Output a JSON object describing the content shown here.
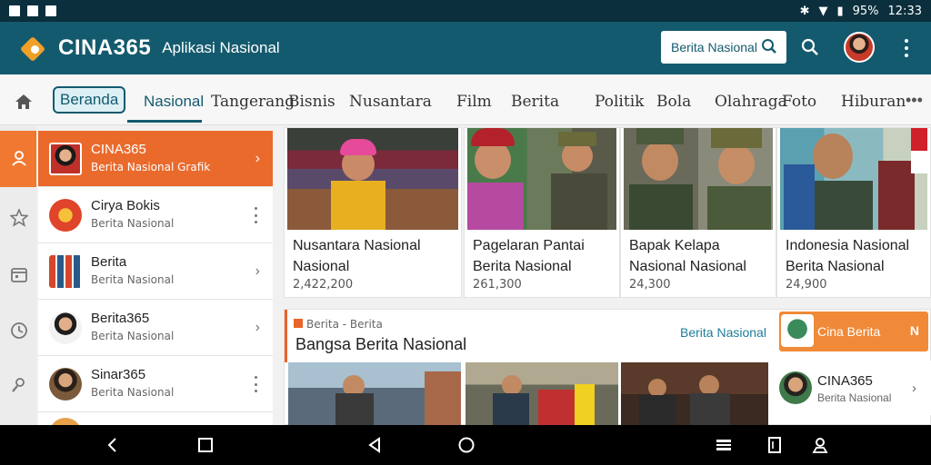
{
  "status": {
    "battery": "95%",
    "time": "12:33"
  },
  "app": {
    "brand": "CINA365",
    "tagline": "Aplikasi Nasional"
  },
  "search": {
    "placeholder": "Berita Nasional"
  },
  "tabs": [
    "Beranda",
    "Nasional",
    "Tangerang",
    "Bisnis",
    "Nusantara",
    "Film",
    "Berita",
    "Politik",
    "Bola",
    "Olahraga",
    "Foto",
    "Hiburan"
  ],
  "sidebar": {
    "items": [
      {
        "title": "CINA365",
        "subtitle": "Berita Nasional Grafik",
        "control": "chevron"
      },
      {
        "title": "Cirya Bokis",
        "subtitle": "Berita Nasional",
        "control": "dots"
      },
      {
        "title": "Berita",
        "subtitle": "Berita Nasional",
        "control": "chevron"
      },
      {
        "title": "Berita365",
        "subtitle": "Berita Nasional",
        "control": "chevron"
      },
      {
        "title": "Sinar365",
        "subtitle": "Berita Nasional",
        "control": "dots"
      }
    ]
  },
  "cards": [
    {
      "title": "Nusantara Nasional Nasional",
      "meta": "2,422,200"
    },
    {
      "title": "Pagelaran Pantai Berita Nasional",
      "meta": "261,300"
    },
    {
      "title": "Bapak Kelapa Nasional Nasional",
      "meta": "24,300"
    },
    {
      "title": "Indonesia Nasional Berita Nasional",
      "meta": "24,900"
    }
  ],
  "featured": {
    "category": "Berita - Berita",
    "headline": "Bangsa Berita Nasional",
    "link": "Berita Nasional",
    "promo": "Cina Berita",
    "promo_arrow": "N",
    "mini_title": "CINA365",
    "mini_sub": "Berita Nasional"
  }
}
